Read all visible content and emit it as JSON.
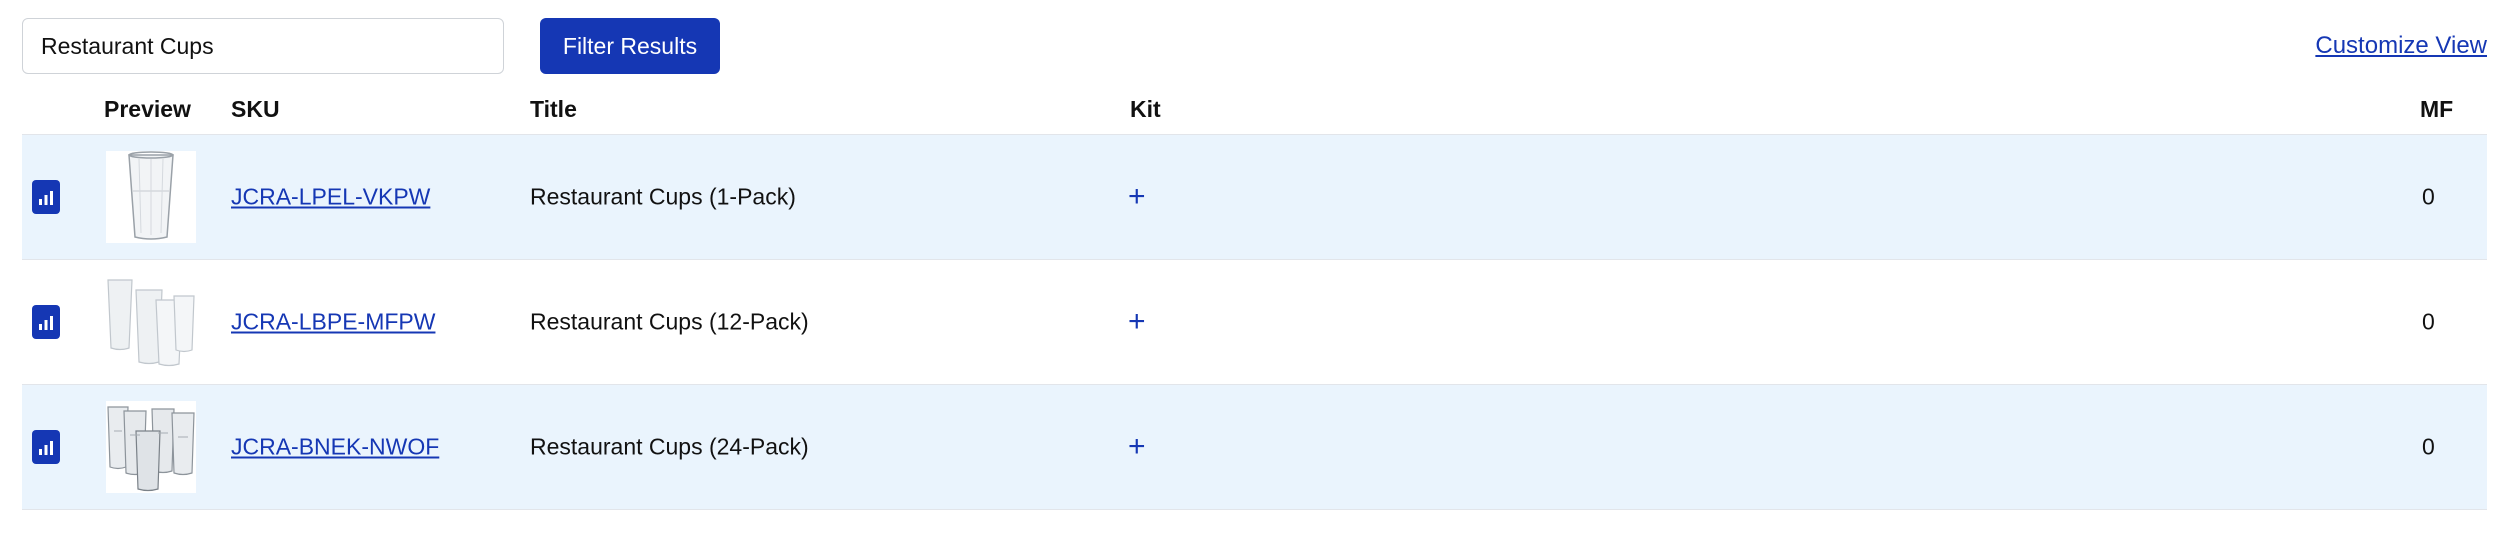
{
  "search": {
    "value": "Restaurant Cups",
    "placeholder": ""
  },
  "toolbar": {
    "filter_label": "Filter Results",
    "customize_label": "Customize View"
  },
  "table": {
    "columns": {
      "preview": "Preview",
      "sku": "SKU",
      "title": "Title",
      "kit": "Kit",
      "mf": "MF"
    },
    "rows": [
      {
        "sku": "JCRA-LPEL-VKPW",
        "title": "Restaurant Cups (1-Pack)",
        "kit": "+",
        "mf": "0",
        "pack": 1
      },
      {
        "sku": "JCRA-LBPE-MFPW",
        "title": "Restaurant Cups (12-Pack)",
        "kit": "+",
        "mf": "0",
        "pack": 12
      },
      {
        "sku": "JCRA-BNEK-NWOF",
        "title": "Restaurant Cups (24-Pack)",
        "kit": "+",
        "mf": "0",
        "pack": 24
      }
    ]
  },
  "colors": {
    "accent": "#1537b4",
    "row_highlight": "#eaf4fd",
    "border": "#e2e5ea"
  },
  "icons": {
    "stats": "bar-chart-icon",
    "kit_add": "plus-icon"
  }
}
